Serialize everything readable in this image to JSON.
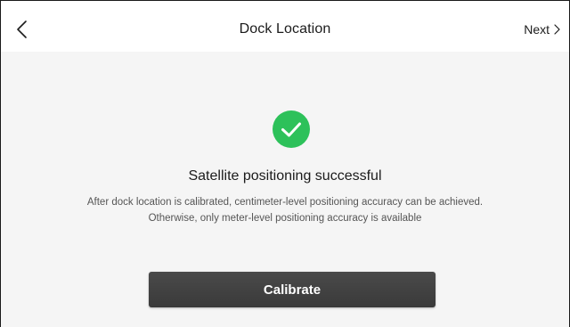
{
  "header": {
    "title": "Dock Location",
    "next_label": "Next",
    "back_icon": "chevron-left-icon",
    "next_icon": "chevron-right-icon"
  },
  "status": {
    "icon": "check-circle-icon",
    "icon_color": "#2dc15a",
    "headline": "Satellite positioning successful",
    "description_line1": "After dock location is calibrated, centimeter-level positioning accuracy can be achieved.",
    "description_line2": "Otherwise, only meter-level positioning accuracy is available"
  },
  "actions": {
    "calibrate_label": "Calibrate",
    "button_color": "#444444"
  }
}
